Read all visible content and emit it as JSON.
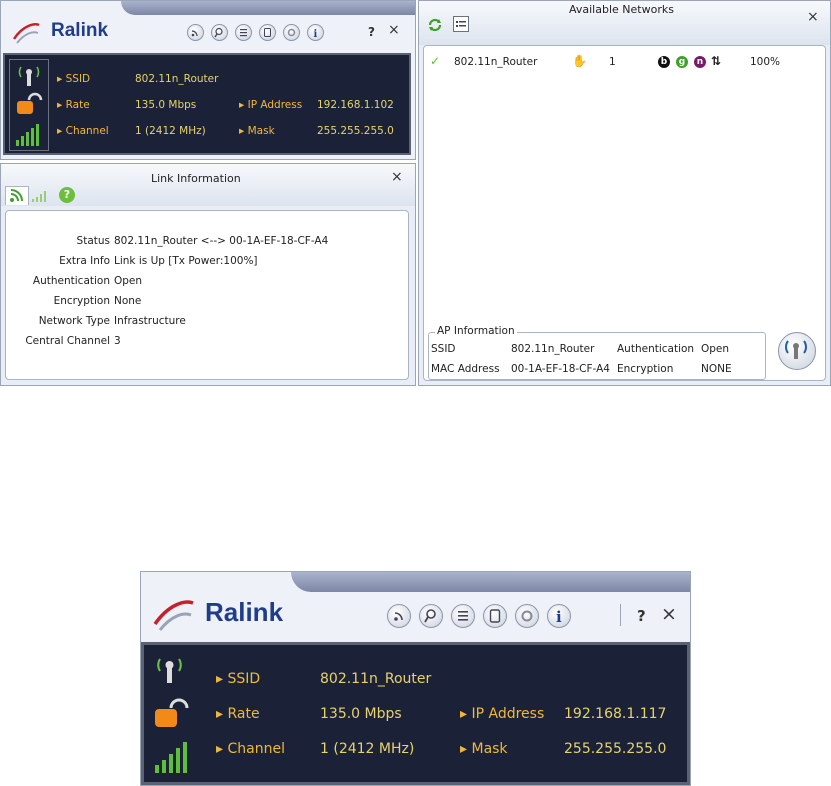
{
  "top_panel": {
    "logo": "Ralink",
    "toolbar_icons": [
      "rss-icon",
      "search-icon",
      "list-icon",
      "profile-icon",
      "settings-icon",
      "info-icon"
    ],
    "help_label": "?",
    "close_label": "×",
    "ssid_label": "SSID",
    "ssid_value": "802.11n_Router",
    "rate_label": "Rate",
    "rate_value": "135.0 Mbps",
    "channel_label": "Channel",
    "channel_value": "1 (2412 MHz)",
    "ip_label": "IP Address",
    "ip_value": "192.168.1.102",
    "mask_label": "Mask",
    "mask_value": "255.255.255.0"
  },
  "link_info": {
    "title": "Link Information",
    "close_label": "×",
    "rows": [
      {
        "key": "Status",
        "value": "802.11n_Router <--> 00-1A-EF-18-CF-A4"
      },
      {
        "key": "Extra Info",
        "value": "Link is Up  [Tx Power:100%]"
      },
      {
        "key": "Authentication",
        "value": "Open"
      },
      {
        "key": "Encryption",
        "value": "None"
      },
      {
        "key": "Network Type",
        "value": "Infrastructure"
      },
      {
        "key": "Central Channel",
        "value": "3"
      }
    ]
  },
  "available_networks": {
    "title": "Available Networks",
    "close_label": "×",
    "networks": [
      {
        "ssid": "802.11n_Router",
        "channel": "1",
        "badges": [
          "b",
          "g",
          "n"
        ],
        "signal": "100%"
      }
    ],
    "ap_info": {
      "legend": "AP Information",
      "ssid_label": "SSID",
      "ssid_value": "802.11n_Router",
      "auth_label": "Authentication",
      "auth_value": "Open",
      "mac_label": "MAC Address",
      "mac_value": "00-1A-EF-18-CF-A4",
      "enc_label": "Encryption",
      "enc_value": "NONE"
    }
  },
  "bottom_panel": {
    "logo": "Ralink",
    "help_label": "?",
    "close_label": "×",
    "ssid_label": "SSID",
    "ssid_value": "802.11n_Router",
    "rate_label": "Rate",
    "rate_value": "135.0 Mbps",
    "channel_label": "Channel",
    "channel_value": "1 (2412 MHz)",
    "ip_label": "IP Address",
    "ip_value": "192.168.1.117",
    "mask_label": "Mask",
    "mask_value": "255.255.255.0"
  },
  "colors": {
    "panel_dark": "#1b2238",
    "label_orange": "#f0b83a",
    "value_yellow": "#e8d26e",
    "logo_blue": "#1f3d8a",
    "signal_green": "#5fbf3a"
  }
}
